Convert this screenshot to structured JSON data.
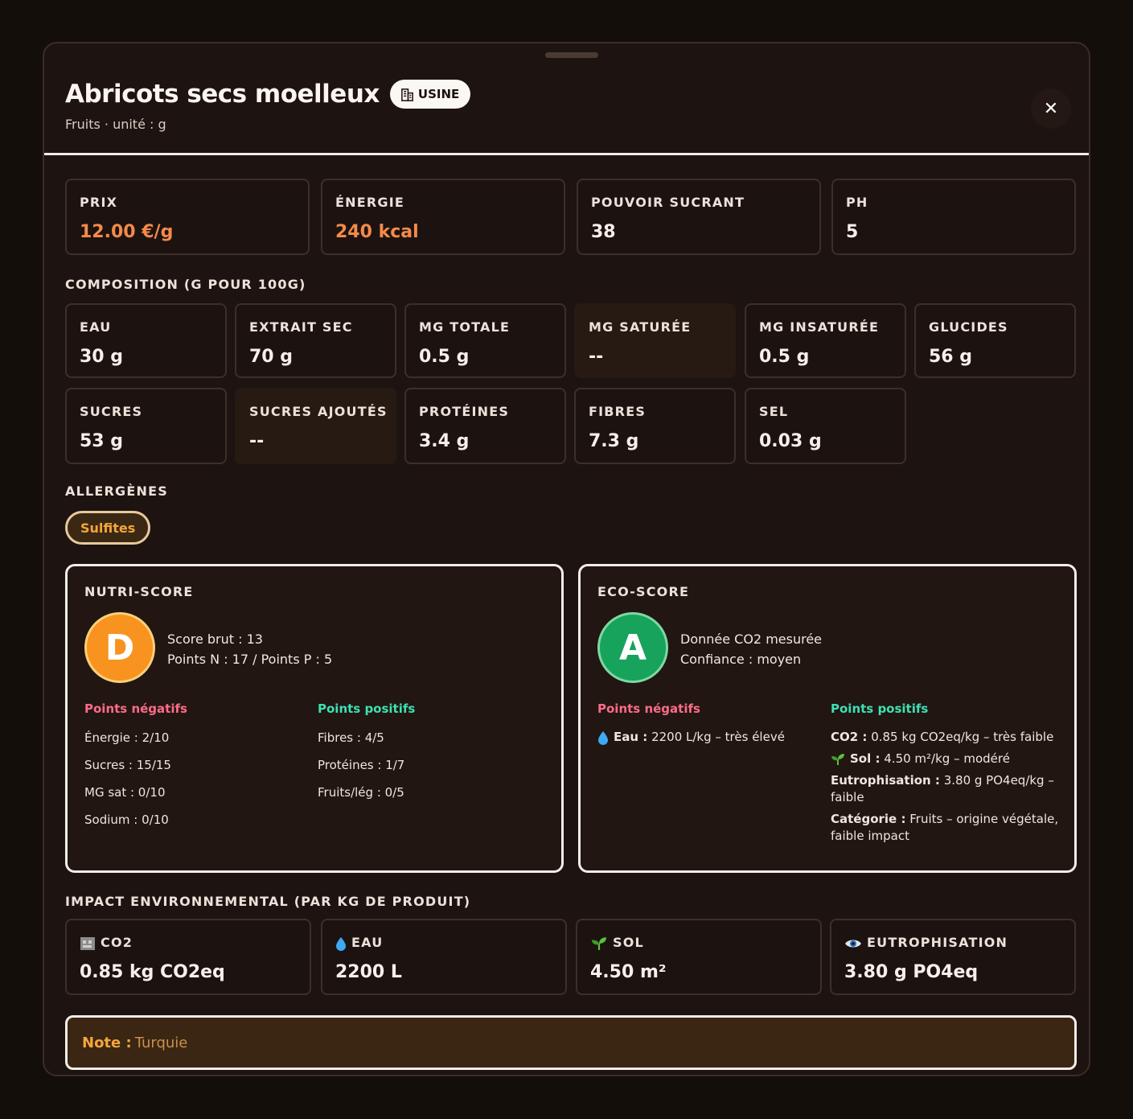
{
  "header": {
    "title": "Abricots secs moelleux",
    "badge": "USINE",
    "subtitle": "Fruits · unité : g",
    "close": "✕"
  },
  "stats": [
    {
      "label": "PRIX",
      "value": "12.00 €/g"
    },
    {
      "label": "ÉNERGIE",
      "value": "240 kcal"
    },
    {
      "label": "POUVOIR SUCRANT",
      "value": "38"
    },
    {
      "label": "PH",
      "value": "5"
    }
  ],
  "composition": {
    "title": "COMPOSITION (G POUR 100G)",
    "items": [
      {
        "label": "EAU",
        "value": "30 g"
      },
      {
        "label": "EXTRAIT SEC",
        "value": "70 g"
      },
      {
        "label": "MG TOTALE",
        "value": "0.5 g"
      },
      {
        "label": "MG SATURÉE",
        "value": "--"
      },
      {
        "label": "MG INSATURÉE",
        "value": "0.5 g"
      },
      {
        "label": "GLUCIDES",
        "value": "56 g"
      },
      {
        "label": "SUCRES",
        "value": "53 g"
      },
      {
        "label": "SUCRES AJOUTÉS",
        "value": "--"
      },
      {
        "label": "PROTÉINES",
        "value": "3.4 g"
      },
      {
        "label": "FIBRES",
        "value": "7.3 g"
      },
      {
        "label": "SEL",
        "value": "0.03 g"
      }
    ]
  },
  "allergens": {
    "title": "ALLERGÈNES",
    "items": [
      "Sulfites"
    ]
  },
  "nutri": {
    "title": "NUTRI-SCORE",
    "grade": "D",
    "line1": "Score brut : 13",
    "line2": "Points N : 17 / Points P : 5",
    "neg_title": "Points négatifs",
    "pos_title": "Points positifs",
    "neg": [
      "Énergie : 2/10",
      "Sucres : 15/15",
      "MG sat : 0/10",
      "Sodium : 0/10"
    ],
    "pos": [
      "Fibres : 4/5",
      "Protéines : 1/7",
      "Fruits/lég : 0/5"
    ]
  },
  "eco": {
    "title": "ECO-SCORE",
    "grade": "A",
    "line1": "Donnée CO2 mesurée",
    "line2": "Confiance : moyen",
    "neg_title": "Points négatifs",
    "pos_title": "Points positifs",
    "neg": [
      {
        "k": "Eau :",
        "v": "2200 L/kg – très élevé"
      }
    ],
    "pos": [
      {
        "k": "CO2 :",
        "v": "0.85 kg CO2eq/kg – très faible"
      },
      {
        "k": "Sol :",
        "v": "4.50 m²/kg – modéré"
      },
      {
        "k": "Eutrophisation :",
        "v": "3.80 g PO4eq/kg – faible"
      },
      {
        "k": "Catégorie :",
        "v": "Fruits – origine végétale, faible impact"
      }
    ]
  },
  "impact": {
    "title": "IMPACT ENVIRONNEMENTAL (PAR KG DE PRODUIT)",
    "items": [
      {
        "label": "CO2",
        "value": "0.85 kg CO2eq",
        "icon": "factory-icon"
      },
      {
        "label": "EAU",
        "value": "2200 L",
        "icon": "droplet-icon"
      },
      {
        "label": "SOL",
        "value": "4.50 m²",
        "icon": "seedling-icon"
      },
      {
        "label": "EUTROPHISATION",
        "value": "3.80 g PO4eq",
        "icon": "eye-icon"
      }
    ]
  },
  "note": {
    "key": "Note :",
    "value": "Turquie"
  },
  "colors": {
    "accent": "#f48a4a",
    "nutri_d": "#f7931e",
    "eco_a": "#17a35b",
    "neg": "#ff6b8a",
    "pos": "#3ee0b4"
  }
}
